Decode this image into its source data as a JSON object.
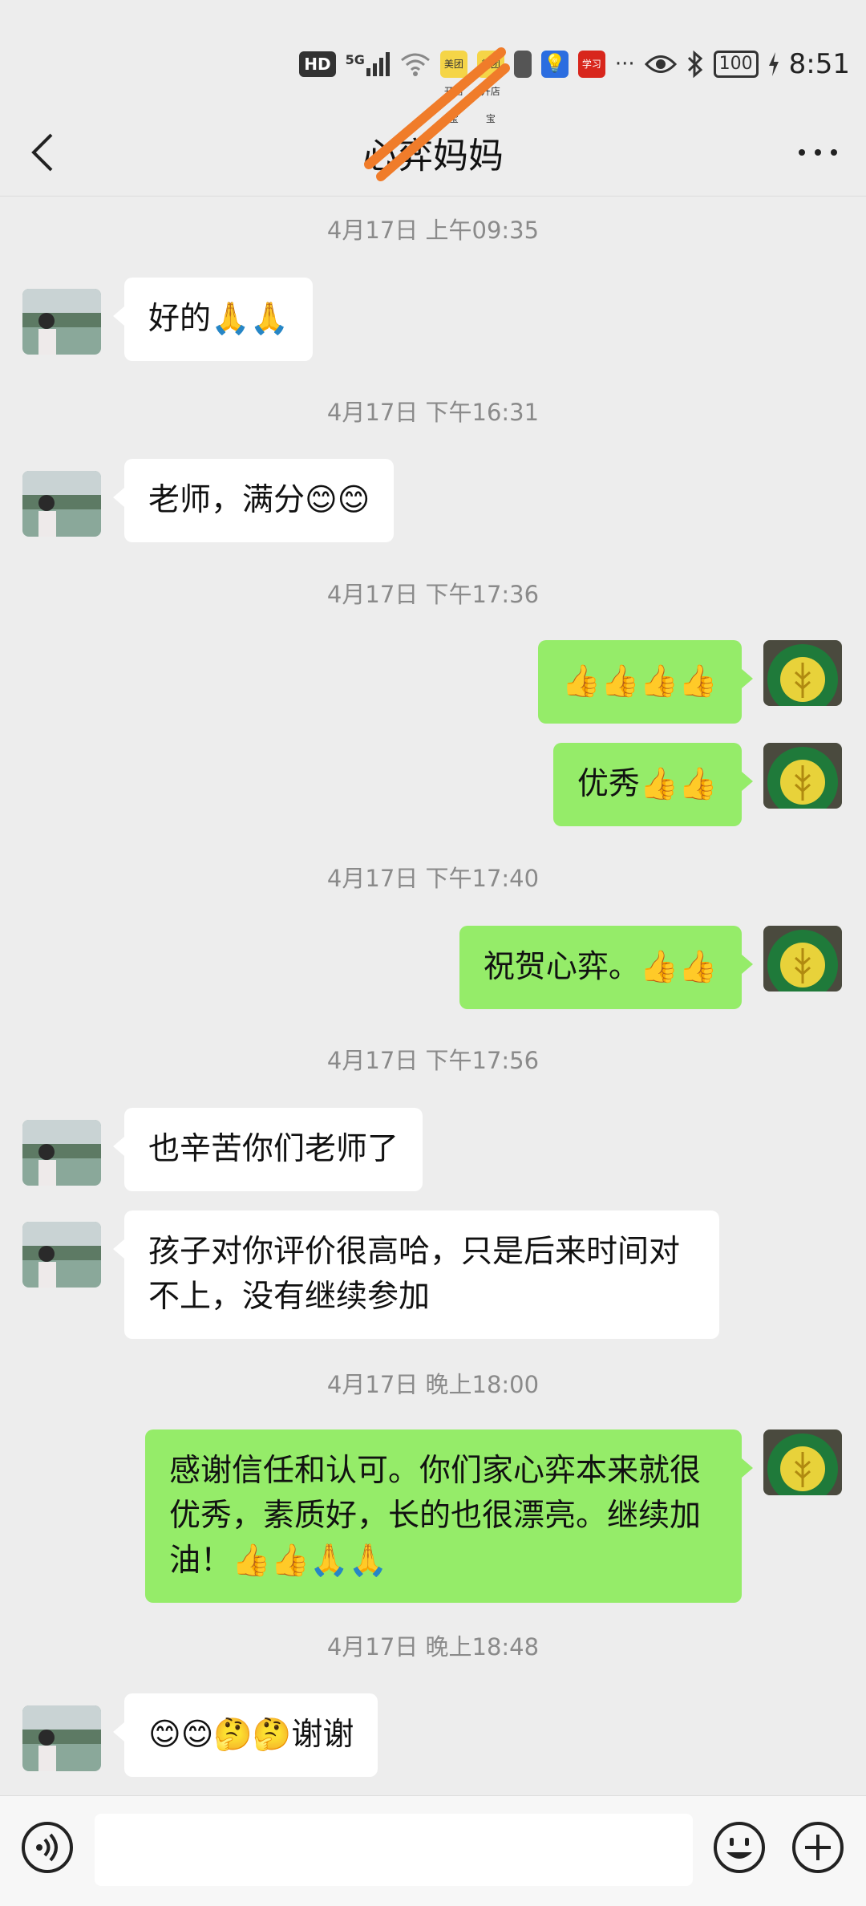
{
  "status_bar": {
    "hd": "HD",
    "network": "5G",
    "app_icon_1": "美团开店宝",
    "app_icon_2": "美团开店宝",
    "app_icon_4": "学习",
    "more": "···",
    "battery": "100",
    "time": "8:51"
  },
  "header": {
    "title": "心弈妈妈"
  },
  "messages": [
    {
      "type": "time",
      "text": "4月17日 上午09:35"
    },
    {
      "type": "msg",
      "side": "left",
      "text": "好的🙏🙏"
    },
    {
      "type": "time",
      "text": "4月17日 下午16:31"
    },
    {
      "type": "msg",
      "side": "left",
      "text": "老师，满分😊😊"
    },
    {
      "type": "time",
      "text": "4月17日 下午17:36"
    },
    {
      "type": "msg",
      "side": "right",
      "text": "👍👍👍👍"
    },
    {
      "type": "msg",
      "side": "right",
      "text": "优秀👍👍"
    },
    {
      "type": "time",
      "text": "4月17日 下午17:40"
    },
    {
      "type": "msg",
      "side": "right",
      "text": "祝贺心弈。👍👍"
    },
    {
      "type": "time",
      "text": "4月17日 下午17:56"
    },
    {
      "type": "msg",
      "side": "left",
      "text": "也辛苦你们老师了"
    },
    {
      "type": "msg",
      "side": "left",
      "text": "孩子对你评价很高哈，只是后来时间对不上，没有继续参加"
    },
    {
      "type": "time",
      "text": "4月17日 晚上18:00"
    },
    {
      "type": "msg",
      "side": "right",
      "text": "感谢信任和认可。你们家心弈本来就很优秀，素质好，长的也很漂亮。继续加油！👍👍🙏🙏"
    },
    {
      "type": "time",
      "text": "4月17日 晚上18:48"
    },
    {
      "type": "msg",
      "side": "left",
      "text": "😊😊🤔🤔谢谢"
    }
  ],
  "input_bar": {
    "placeholder": ""
  },
  "icons": {
    "back": "chevron-left-icon",
    "more": "more-dots-icon",
    "voice": "voice-icon",
    "emoji": "emoji-icon",
    "plus": "plus-icon"
  },
  "colors": {
    "background": "#ededed",
    "bubble_right": "#95ec69",
    "bubble_left": "#ffffff",
    "timestamp": "#8a8a8a"
  }
}
